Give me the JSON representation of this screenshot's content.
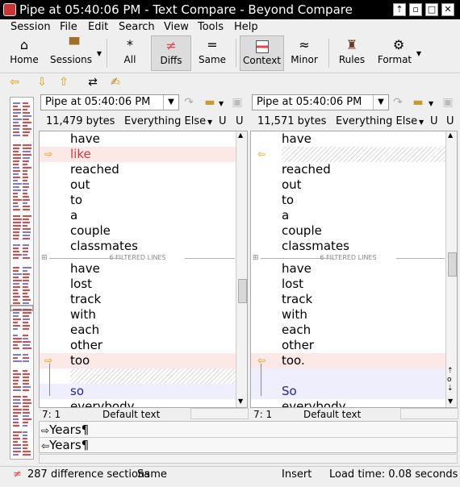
{
  "window": {
    "title": "Pipe at 05:40:06 PM - Text Compare - Beyond Compare",
    "buttons": [
      "restore-up-icon",
      "minimize-icon",
      "maximize-icon",
      "close-icon"
    ]
  },
  "menu": [
    "Session",
    "File",
    "Edit",
    "Search",
    "View",
    "Tools",
    "Help"
  ],
  "toolbar": {
    "home": {
      "label": "Home",
      "icon": "house-icon"
    },
    "sessions": {
      "label": "Sessions",
      "icon": "briefcase-icon"
    },
    "all": {
      "label": "All",
      "icon": "asterisk-icon",
      "glyph": "*"
    },
    "diffs": {
      "label": "Diffs",
      "icon": "not-equal-icon",
      "glyph": "≠"
    },
    "same": {
      "label": "Same",
      "icon": "equal-icon",
      "glyph": "="
    },
    "context": {
      "label": "Context",
      "icon": "context-icon"
    },
    "minor": {
      "label": "Minor",
      "icon": "approx-icon",
      "glyph": "≈"
    },
    "rules": {
      "label": "Rules",
      "icon": "referee-icon"
    },
    "format": {
      "label": "Format",
      "icon": "format-icon"
    }
  },
  "left": {
    "file": "Pipe at 05:40:06 PM",
    "size": "11,479 bytes",
    "format": "Everything Else",
    "flag1": "U",
    "flag2": "U",
    "position": "7: 1",
    "mode": "Default text",
    "top_lines": [
      "have",
      "like",
      "reached",
      "out",
      "to",
      "a",
      "couple",
      "classmates"
    ],
    "bottom_lines": [
      "have",
      "lost",
      "track",
      "with",
      "each",
      "other",
      "too",
      "",
      "so",
      "everybody"
    ]
  },
  "right": {
    "file": "Pipe at 05:40:06 PM",
    "size": "11,571 bytes",
    "format": "Everything Else",
    "flag1": "U",
    "flag2": "U",
    "position": "7: 1",
    "mode": "Default text",
    "top_lines": [
      "have",
      "",
      "reached",
      "out",
      "to",
      "a",
      "couple",
      "classmates"
    ],
    "bottom_lines": [
      "have",
      "lost",
      "track",
      "with",
      "each",
      "other",
      "too.",
      "",
      "So",
      "everybody"
    ]
  },
  "filtered_label": "6 FILTERED LINES",
  "detail": {
    "line1": "Years¶",
    "line2": "Years¶"
  },
  "status": {
    "diff_count": "287 difference sections",
    "same": "Same",
    "mode": "Insert",
    "load_time": "Load time: 0.08 seconds"
  },
  "colors": {
    "diff_text": "#d23a3a",
    "diff_bg": "#fde8e8",
    "blue_text": "#2222aa",
    "arrow": "#d8a000",
    "accent_red": "#e04848"
  }
}
